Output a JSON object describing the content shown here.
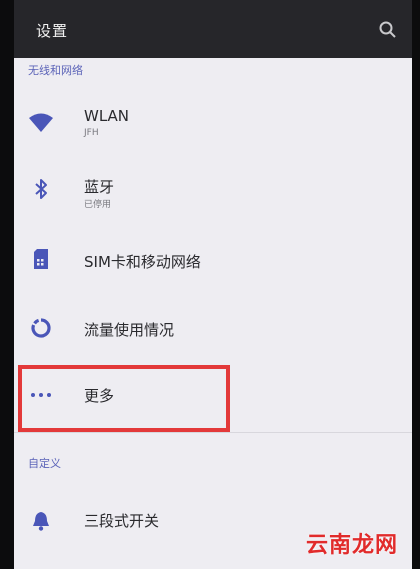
{
  "header": {
    "title": "设置",
    "search_icon": "search-icon"
  },
  "sections": [
    {
      "header": "无线和网络",
      "items": [
        {
          "id": "wlan",
          "label": "WLAN",
          "sub": "JFH",
          "icon": "wifi-icon"
        },
        {
          "id": "bluetooth",
          "label": "蓝牙",
          "sub": "已停用",
          "icon": "bluetooth-icon"
        },
        {
          "id": "sim",
          "label": "SIM卡和移动网络",
          "sub": "",
          "icon": "sim-card-icon"
        },
        {
          "id": "data-usage",
          "label": "流量使用情况",
          "sub": "",
          "icon": "data-usage-icon"
        },
        {
          "id": "more",
          "label": "更多",
          "sub": "",
          "icon": "more-dots-icon"
        }
      ]
    },
    {
      "header": "自定义",
      "items": [
        {
          "id": "alert-slider",
          "label": "三段式开关",
          "sub": "",
          "icon": "bell-icon"
        }
      ]
    }
  ],
  "watermark": "云南龙网",
  "colors": {
    "accent": "#5b63b8",
    "appbar": "#26262a",
    "background": "#eeedf2",
    "highlight": "#e3393a"
  }
}
